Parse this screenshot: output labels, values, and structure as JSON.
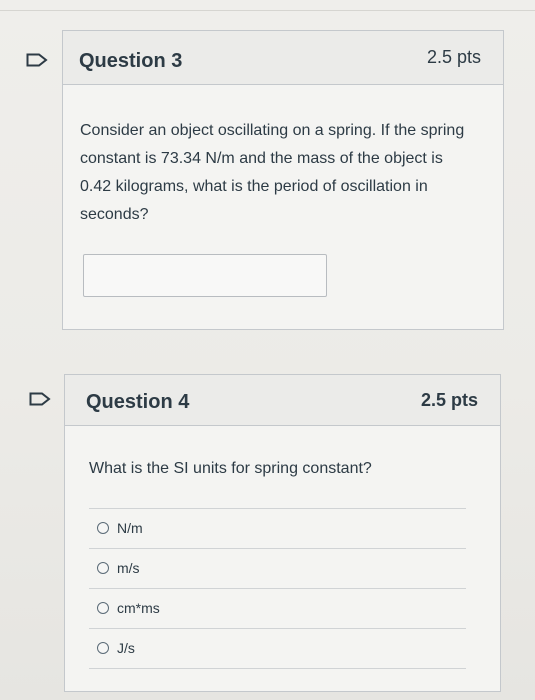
{
  "q3": {
    "title": "Question 3",
    "points": "2.5 pts",
    "text": "Consider an object oscillating on a spring.  If the spring constant is 73.34 N/m and the mass of the object is 0.42 kilograms, what is the period of oscillation in seconds?",
    "answer_value": ""
  },
  "q4": {
    "title": "Question 4",
    "points": "2.5 pts",
    "text": "What is the SI units for spring constant?",
    "options": [
      "N/m",
      "m/s",
      "cm*ms",
      "J/s"
    ]
  },
  "icons": {
    "flag": "flag-question-icon",
    "radio": "radio-unselected-icon"
  },
  "colors": {
    "text": "#2d3b45",
    "border": "#c4c8cc",
    "flag": "#2d3b45"
  }
}
